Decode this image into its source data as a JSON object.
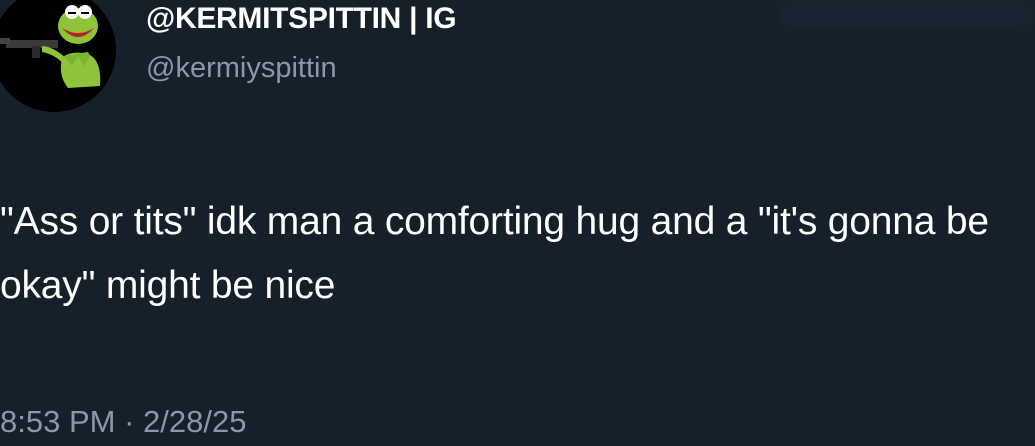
{
  "author": {
    "display_name": "@KERMITSPITTIN | IG",
    "handle": "@kermiyspittin",
    "avatar_icon": "kermit-avatar-icon"
  },
  "tweet": {
    "text": "\"Ass or tits\" idk man a comforting hug and a \"it's gonna be okay\" might be nice",
    "time": "8:53 PM",
    "separator": "·",
    "date": "2/28/25"
  },
  "colors": {
    "background": "#15202b",
    "text": "#ffffff",
    "secondary_text": "#8b98a5"
  }
}
